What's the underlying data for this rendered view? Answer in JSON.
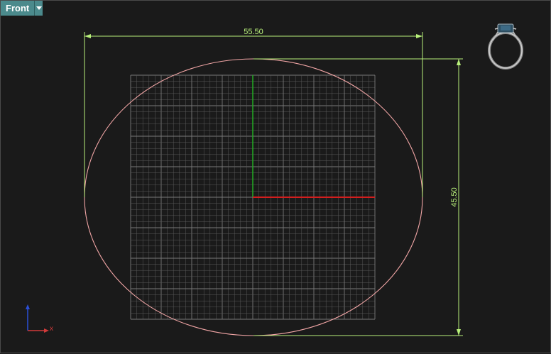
{
  "viewport": {
    "name": "Front",
    "dropdown_icon": "chevron-down-icon"
  },
  "dimensions": {
    "horizontal": {
      "label": "55.50",
      "value": 55.5
    },
    "vertical": {
      "label": "45.50",
      "value": 45.5
    }
  },
  "axis_widget": {
    "x_label": "x",
    "icon": "axis-triad-icon"
  },
  "preview": {
    "icon": "ring-preview-icon"
  },
  "colors": {
    "background": "#1a1a1a",
    "grid_minor": "#5a5a5a",
    "grid_major": "#7a7a7a",
    "x_axis": "#d21e1e",
    "y_axis": "#22aa22",
    "ellipse": "#f2a6a6",
    "dimension": "#b8f07a",
    "tab": "#4b8a8c"
  }
}
